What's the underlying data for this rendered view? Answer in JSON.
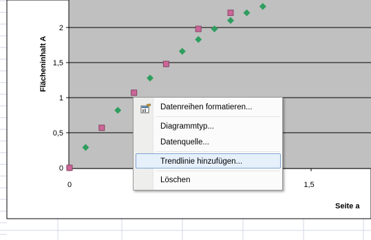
{
  "chart_data": {
    "type": "scatter",
    "xlabel": "Seite a",
    "ylabel": "Flächeninhalt A",
    "x_ticks": [
      "0",
      "1,5"
    ],
    "y_ticks": [
      "0",
      "0,5",
      "1",
      "1,5",
      "2"
    ],
    "xlim": [
      0,
      1.6
    ],
    "ylim": [
      0,
      2.5
    ],
    "grid": true,
    "series": [
      {
        "color": "#2e9e5e",
        "marker": "diamond",
        "points": [
          [
            0.0,
            0.0
          ],
          [
            0.1,
            0.29
          ],
          [
            0.2,
            0.57
          ],
          [
            0.3,
            0.82
          ],
          [
            0.4,
            1.07
          ],
          [
            0.5,
            1.28
          ],
          [
            0.6,
            1.48
          ],
          [
            0.7,
            1.66
          ],
          [
            0.8,
            1.83
          ],
          [
            0.9,
            1.98
          ],
          [
            1.0,
            2.1
          ],
          [
            1.1,
            2.21
          ],
          [
            1.2,
            2.3
          ]
        ]
      },
      {
        "color": "#cc6699",
        "marker": "square",
        "points": [
          [
            0.0,
            0.0
          ],
          [
            0.2,
            0.57
          ],
          [
            0.4,
            1.07
          ],
          [
            0.6,
            1.48
          ],
          [
            0.8,
            1.98
          ],
          [
            1.0,
            2.21
          ]
        ]
      }
    ]
  },
  "context_menu": {
    "items": [
      {
        "label": "Datenreihen formatieren..."
      },
      {
        "label": "Diagrammtyp..."
      },
      {
        "label": "Datenquelle..."
      },
      {
        "label": "Trendlinie hinzufügen..."
      },
      {
        "label": "Löschen"
      }
    ]
  },
  "colors": {
    "plot_area": "#c0c0c0",
    "menu_highlight": "#e6f0fb",
    "menu_highlight_border": "#7da2ce"
  }
}
